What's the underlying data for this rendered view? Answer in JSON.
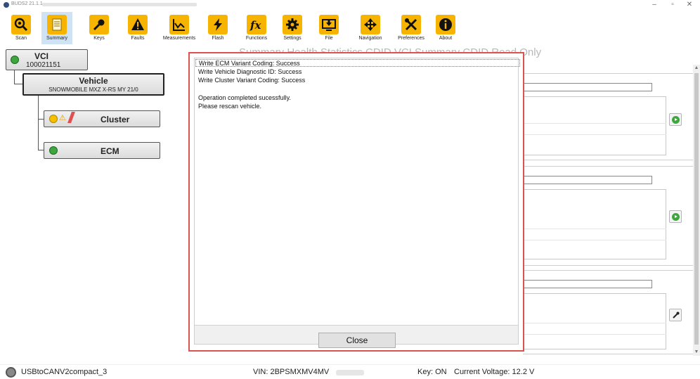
{
  "window": {
    "title": "BUDS2 21.1.1",
    "controls": [
      "–",
      "▫",
      "✕"
    ]
  },
  "toolbar": {
    "active": "Summary",
    "items": [
      {
        "label": "Scan",
        "icon": "scan-magnifier-icon"
      },
      {
        "label": "Summary",
        "icon": "summary-document-icon"
      },
      {
        "label": "Keys",
        "icon": "key-icon"
      },
      {
        "label": "Faults",
        "icon": "warning-triangle-icon"
      },
      {
        "label": "Measurements",
        "icon": "line-graph-icon"
      },
      {
        "label": "Flash",
        "icon": "lightning-bolt-icon"
      },
      {
        "label": "Functions",
        "icon": "fx-icon"
      },
      {
        "label": "Settings",
        "icon": "gear-icon"
      },
      {
        "label": "File",
        "icon": "monitor-download-icon"
      },
      {
        "label": "Navigation",
        "icon": "navigation-arrows-icon"
      },
      {
        "label": "Preferences",
        "icon": "wrench-screwdriver-icon"
      },
      {
        "label": "About",
        "icon": "info-icon"
      }
    ]
  },
  "tree": {
    "vci": {
      "title": "VCI",
      "id": "100021151",
      "status": "ok"
    },
    "vehicle": {
      "title": "Vehicle",
      "model": "SNOWMOBILE MXZ X-RS MY 21/0"
    },
    "modules": [
      {
        "label": "Cluster",
        "status": "warning"
      },
      {
        "label": "ECM",
        "status": "ok"
      }
    ]
  },
  "tabs_partial": "Summary  Health  Statistics  CDID  VCI Summary  CDID Read Only",
  "dialog": {
    "lines": [
      "Write ECM Variant Coding: Success",
      "Write Vehicle Diagnostic ID: Success",
      "Write Cluster Variant Coding: Success",
      "",
      "Operation completed sucessfully.",
      "Please rescan vehicle."
    ],
    "close_label": "Close"
  },
  "status_bar": {
    "device": "USBtoCANV2compact_3",
    "vin": "VIN: 2BPSMXMV4MV",
    "key": "Key: ON",
    "voltage": "Current Voltage: 12.2 V"
  },
  "colors": {
    "accent_yellow": "#f6b400",
    "active_tab": "#cfe3f5",
    "dialog_border": "#d9534f",
    "ok_green": "#3fa63f"
  }
}
